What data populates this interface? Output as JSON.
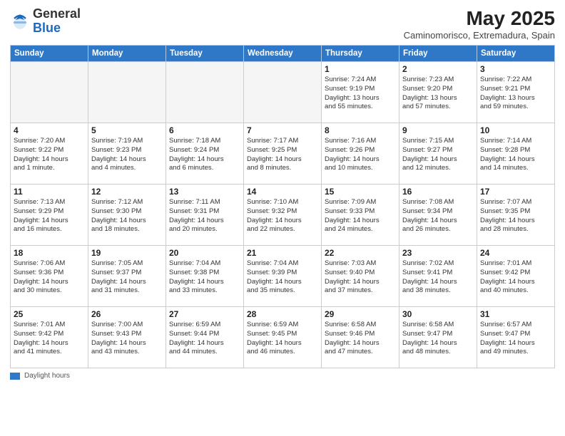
{
  "header": {
    "logo_general": "General",
    "logo_blue": "Blue",
    "month": "May 2025",
    "location": "Caminomorisco, Extremadura, Spain"
  },
  "days_of_week": [
    "Sunday",
    "Monday",
    "Tuesday",
    "Wednesday",
    "Thursday",
    "Friday",
    "Saturday"
  ],
  "weeks": [
    [
      {
        "day": "",
        "info": ""
      },
      {
        "day": "",
        "info": ""
      },
      {
        "day": "",
        "info": ""
      },
      {
        "day": "",
        "info": ""
      },
      {
        "day": "1",
        "info": "Sunrise: 7:24 AM\nSunset: 9:19 PM\nDaylight: 13 hours\nand 55 minutes."
      },
      {
        "day": "2",
        "info": "Sunrise: 7:23 AM\nSunset: 9:20 PM\nDaylight: 13 hours\nand 57 minutes."
      },
      {
        "day": "3",
        "info": "Sunrise: 7:22 AM\nSunset: 9:21 PM\nDaylight: 13 hours\nand 59 minutes."
      }
    ],
    [
      {
        "day": "4",
        "info": "Sunrise: 7:20 AM\nSunset: 9:22 PM\nDaylight: 14 hours\nand 1 minute."
      },
      {
        "day": "5",
        "info": "Sunrise: 7:19 AM\nSunset: 9:23 PM\nDaylight: 14 hours\nand 4 minutes."
      },
      {
        "day": "6",
        "info": "Sunrise: 7:18 AM\nSunset: 9:24 PM\nDaylight: 14 hours\nand 6 minutes."
      },
      {
        "day": "7",
        "info": "Sunrise: 7:17 AM\nSunset: 9:25 PM\nDaylight: 14 hours\nand 8 minutes."
      },
      {
        "day": "8",
        "info": "Sunrise: 7:16 AM\nSunset: 9:26 PM\nDaylight: 14 hours\nand 10 minutes."
      },
      {
        "day": "9",
        "info": "Sunrise: 7:15 AM\nSunset: 9:27 PM\nDaylight: 14 hours\nand 12 minutes."
      },
      {
        "day": "10",
        "info": "Sunrise: 7:14 AM\nSunset: 9:28 PM\nDaylight: 14 hours\nand 14 minutes."
      }
    ],
    [
      {
        "day": "11",
        "info": "Sunrise: 7:13 AM\nSunset: 9:29 PM\nDaylight: 14 hours\nand 16 minutes."
      },
      {
        "day": "12",
        "info": "Sunrise: 7:12 AM\nSunset: 9:30 PM\nDaylight: 14 hours\nand 18 minutes."
      },
      {
        "day": "13",
        "info": "Sunrise: 7:11 AM\nSunset: 9:31 PM\nDaylight: 14 hours\nand 20 minutes."
      },
      {
        "day": "14",
        "info": "Sunrise: 7:10 AM\nSunset: 9:32 PM\nDaylight: 14 hours\nand 22 minutes."
      },
      {
        "day": "15",
        "info": "Sunrise: 7:09 AM\nSunset: 9:33 PM\nDaylight: 14 hours\nand 24 minutes."
      },
      {
        "day": "16",
        "info": "Sunrise: 7:08 AM\nSunset: 9:34 PM\nDaylight: 14 hours\nand 26 minutes."
      },
      {
        "day": "17",
        "info": "Sunrise: 7:07 AM\nSunset: 9:35 PM\nDaylight: 14 hours\nand 28 minutes."
      }
    ],
    [
      {
        "day": "18",
        "info": "Sunrise: 7:06 AM\nSunset: 9:36 PM\nDaylight: 14 hours\nand 30 minutes."
      },
      {
        "day": "19",
        "info": "Sunrise: 7:05 AM\nSunset: 9:37 PM\nDaylight: 14 hours\nand 31 minutes."
      },
      {
        "day": "20",
        "info": "Sunrise: 7:04 AM\nSunset: 9:38 PM\nDaylight: 14 hours\nand 33 minutes."
      },
      {
        "day": "21",
        "info": "Sunrise: 7:04 AM\nSunset: 9:39 PM\nDaylight: 14 hours\nand 35 minutes."
      },
      {
        "day": "22",
        "info": "Sunrise: 7:03 AM\nSunset: 9:40 PM\nDaylight: 14 hours\nand 37 minutes."
      },
      {
        "day": "23",
        "info": "Sunrise: 7:02 AM\nSunset: 9:41 PM\nDaylight: 14 hours\nand 38 minutes."
      },
      {
        "day": "24",
        "info": "Sunrise: 7:01 AM\nSunset: 9:42 PM\nDaylight: 14 hours\nand 40 minutes."
      }
    ],
    [
      {
        "day": "25",
        "info": "Sunrise: 7:01 AM\nSunset: 9:42 PM\nDaylight: 14 hours\nand 41 minutes."
      },
      {
        "day": "26",
        "info": "Sunrise: 7:00 AM\nSunset: 9:43 PM\nDaylight: 14 hours\nand 43 minutes."
      },
      {
        "day": "27",
        "info": "Sunrise: 6:59 AM\nSunset: 9:44 PM\nDaylight: 14 hours\nand 44 minutes."
      },
      {
        "day": "28",
        "info": "Sunrise: 6:59 AM\nSunset: 9:45 PM\nDaylight: 14 hours\nand 46 minutes."
      },
      {
        "day": "29",
        "info": "Sunrise: 6:58 AM\nSunset: 9:46 PM\nDaylight: 14 hours\nand 47 minutes."
      },
      {
        "day": "30",
        "info": "Sunrise: 6:58 AM\nSunset: 9:47 PM\nDaylight: 14 hours\nand 48 minutes."
      },
      {
        "day": "31",
        "info": "Sunrise: 6:57 AM\nSunset: 9:47 PM\nDaylight: 14 hours\nand 49 minutes."
      }
    ]
  ],
  "footer": {
    "daylight_label": "Daylight hours"
  }
}
